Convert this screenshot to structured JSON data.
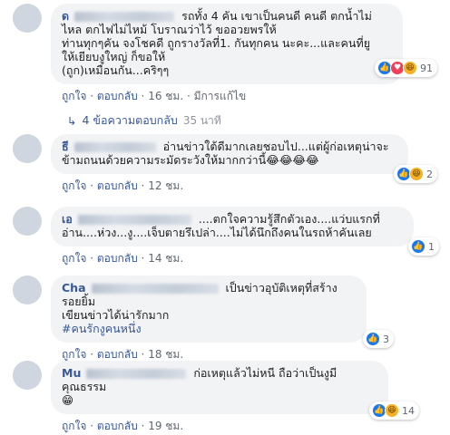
{
  "comments": [
    {
      "author": "ด",
      "lines": [
        "รถทั้ง 4 คัน เขาเป็นคนดี คนดี ตกน้ำไม่ไหล ตกไฟไม่ไหม้ โบราณว่าไว้ ขออวยพรให้",
        "ท่านทุกๆคัน จงโชคดี ถูกรางวัลที่1. กันทุกคน นะคะ...และคนที่ยู",
        "ให้เยียบงูใหญ่ ก็ขอให้",
        "(ถูก)เหมือนกัน...คริๆๆ"
      ],
      "like": "ถูกใจ",
      "reply": "ตอบกลับ",
      "time": "16 ชม.",
      "extra": "มีการแก้ไข",
      "reaction_count": "91"
    },
    {
      "author": "ธี",
      "lines": [
        "อ่านข่าวใต้ดีมากเลยชอบไป...แต่ผู้ก่อเหตุน่าจะ",
        "ข้ามถนนด้วยความระมัดระวังให้มากกว่านี้😂😂😂😂"
      ],
      "like": "ถูกใจ",
      "reply": "ตอบกลับ",
      "time": "12 ชม.",
      "reaction_count": "2"
    },
    {
      "author": "เอ",
      "lines": [
        "....ตกใจความรู้สึกตัวเอง....แว่บแรกที่",
        "อ่าน....ห่วง...งู....เจ็บตายรึเปล่า....ไม่ได้นึกถึงคนในรถห้าคันเลย"
      ],
      "like": "ถูกใจ",
      "reply": "ตอบกลับ",
      "time": "14 ชม.",
      "reaction_count": "1"
    },
    {
      "author": "Cha",
      "lines": [
        "เป็นข่าวอุบัติเหตุที่สร้างรอยยิ้ม",
        "เขียนข่าวได้น่ารักมาก"
      ],
      "hashtag": "#คนรักงูคนหนึ่ง",
      "like": "ถูกใจ",
      "reply": "ตอบกลับ",
      "time": "18 ชม.",
      "reaction_count": "3"
    },
    {
      "author": "Mu",
      "lines": [
        "ก่อเหตุแล้วไม่หนี ถือว่าเป็นงูมีคุณธรรม",
        "😁"
      ],
      "like": "ถูกใจ",
      "reply": "ตอบกลับ",
      "time": "19 ชม.",
      "reaction_count": "14"
    }
  ],
  "replies_link": {
    "label": "4 ข้อความตอบกลับ",
    "time": "35 นาที"
  },
  "colors": {
    "link": "#385898",
    "bubble": "#f2f3f5",
    "like": "#1877f2"
  }
}
